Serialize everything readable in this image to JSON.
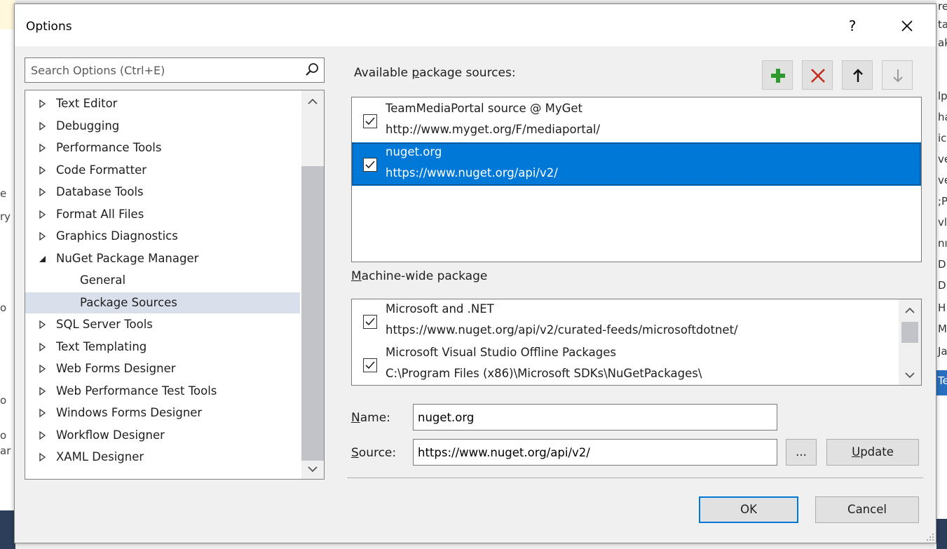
{
  "background": {
    "right_fragments": [
      "re",
      "ta",
      "ak",
      "lp",
      "ha",
      "ic",
      "ve",
      "ve",
      ";P",
      "vl",
      "nı",
      "D",
      "D'",
      "H",
      "M",
      "Ja",
      "Te"
    ],
    "left_fragments": [
      "e",
      "ry",
      "o",
      "o",
      "o",
      "ar"
    ]
  },
  "dialog": {
    "title": "Options",
    "help_label": "?"
  },
  "search": {
    "placeholder": "Search Options (Ctrl+E)"
  },
  "tree": {
    "items": [
      {
        "label": "Text Editor",
        "expanded": false
      },
      {
        "label": "Debugging",
        "expanded": false
      },
      {
        "label": "Performance Tools",
        "expanded": false
      },
      {
        "label": "Code Formatter",
        "expanded": false
      },
      {
        "label": "Database Tools",
        "expanded": false
      },
      {
        "label": "Format All Files",
        "expanded": false
      },
      {
        "label": "Graphics Diagnostics",
        "expanded": false
      },
      {
        "label": "NuGet Package Manager",
        "expanded": true
      },
      {
        "label": "General",
        "child": true
      },
      {
        "label": "Package Sources",
        "child": true,
        "selected": true
      },
      {
        "label": "SQL Server Tools",
        "expanded": false
      },
      {
        "label": "Text Templating",
        "expanded": false
      },
      {
        "label": "Web Forms Designer",
        "expanded": false
      },
      {
        "label": "Web Performance Test Tools",
        "expanded": false
      },
      {
        "label": "Windows Forms Designer",
        "expanded": false
      },
      {
        "label": "Workflow Designer",
        "expanded": false
      },
      {
        "label": "XAML Designer",
        "expanded": false
      }
    ]
  },
  "sources": {
    "label_pre": "Available ",
    "label_u": "p",
    "label_post": "ackage sources:",
    "toolbar": {
      "add": "add-icon",
      "remove": "remove-icon",
      "up": "arrow-up-icon",
      "down": "arrow-down-icon"
    },
    "items": [
      {
        "name": "TeamMediaPortal source @ MyGet",
        "url": "http://www.myget.org/F/mediaportal/",
        "checked": true,
        "selected": false
      },
      {
        "name": "nuget.org",
        "url": "https://www.nuget.org/api/v2/",
        "checked": true,
        "selected": true
      }
    ]
  },
  "machine_wide": {
    "label_u": "M",
    "label_post": "achine-wide package",
    "items": [
      {
        "name": "Microsoft and .NET",
        "url": "https://www.nuget.org/api/v2/curated-feeds/microsoftdotnet/",
        "checked": true
      },
      {
        "name": "Microsoft Visual Studio Offline Packages",
        "url": "C:\\Program Files (x86)\\Microsoft SDKs\\NuGetPackages\\",
        "checked": true
      }
    ]
  },
  "form": {
    "name_label_u": "N",
    "name_label_post": "ame:",
    "name_value": "nuget.org",
    "source_label_u": "S",
    "source_label_post": "ource:",
    "source_value": "https://www.nuget.org/api/v2/",
    "browse_label": "...",
    "update_label_u": "U",
    "update_label_post": "pdate"
  },
  "buttons": {
    "ok": "OK",
    "cancel": "Cancel"
  },
  "colors": {
    "selection": "#0078d7",
    "tree_selection": "#d9e0ec",
    "add_green": "#2e9a2e",
    "remove_red": "#c42b1c"
  }
}
